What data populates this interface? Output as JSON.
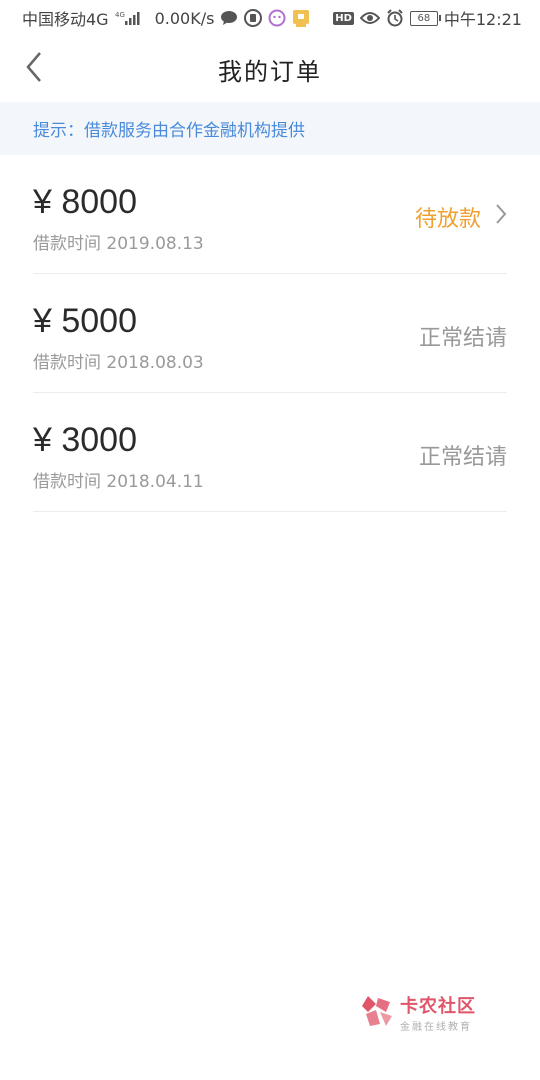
{
  "status_bar": {
    "carrier": "中国移动4G",
    "net_speed": "0.00K/s",
    "battery": "68",
    "time": "中午12:21",
    "hd": "HD"
  },
  "nav": {
    "title": "我的订单"
  },
  "notice": {
    "text": "提示：借款服务由合作金融机构提供"
  },
  "orders": [
    {
      "amount": "¥ 8000",
      "date_label": "借款时间 2019.08.13",
      "status": "待放款"
    },
    {
      "amount": "¥ 5000",
      "date_label": "借款时间 2018.08.03",
      "status": "正常结请"
    },
    {
      "amount": "¥ 3000",
      "date_label": "借款时间 2018.04.11",
      "status": "正常结请"
    }
  ],
  "watermark": {
    "name": "卡农社区",
    "tagline": "金融在线教育"
  },
  "colors": {
    "pending": "#f0a030",
    "notice_text": "#4a8ad9",
    "notice_bg": "#f3f7fc",
    "brand_red": "#e0556a"
  }
}
